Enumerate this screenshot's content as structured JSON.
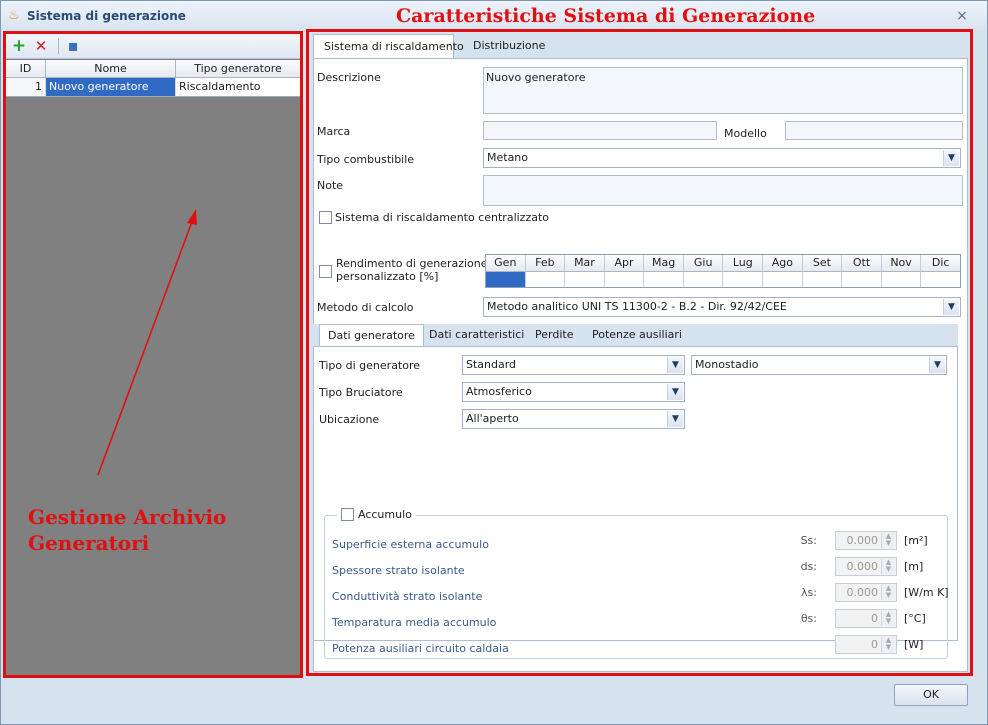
{
  "window": {
    "title": "Sistema di generazione",
    "close": "×"
  },
  "annotations": {
    "right_title": "Caratteristiche Sistema di Generazione",
    "left_title": "Gestione Archivio Generatori"
  },
  "left": {
    "toolbar": {
      "add": "+",
      "delete": "✕",
      "save": "▪"
    },
    "grid": {
      "headers": [
        "ID",
        "Nome",
        "Tipo generatore"
      ],
      "rows": [
        {
          "id": "1",
          "nome": "Nuovo generatore",
          "tipo": "Riscaldamento"
        }
      ]
    }
  },
  "tabs": [
    "Sistema di riscaldamento",
    "Distribuzione"
  ],
  "form": {
    "descrizione_label": "Descrizione",
    "descrizione_value": "Nuovo generatore",
    "marca_label": "Marca",
    "modello_label": "Modello",
    "combustibile_label": "Tipo combustibile",
    "combustibile_value": "Metano",
    "note_label": "Note",
    "centralizzato_label": "Sistema di riscaldamento centralizzato",
    "rendimento_label_1": "Rendimento di generazione",
    "rendimento_label_2": "personalizzato [%]",
    "months": [
      "Gen",
      "Feb",
      "Mar",
      "Apr",
      "Mag",
      "Giu",
      "Lug",
      "Ago",
      "Set",
      "Ott",
      "Nov",
      "Dic"
    ],
    "metodo_label": "Metodo di calcolo",
    "metodo_value": "Metodo analitico UNI TS 11300-2 - B.2 - Dir. 92/42/CEE"
  },
  "subtabs": [
    "Dati generatore",
    "Dati caratteristici",
    "Perdite",
    "Potenze ausiliari"
  ],
  "dati": {
    "tipo_gen_label": "Tipo di generatore",
    "tipo_gen_value": "Standard",
    "stadio_value": "Monostadio",
    "bruciatore_label": "Tipo Bruciatore",
    "bruciatore_value": "Atmosferico",
    "ubicazione_label": "Ubicazione",
    "ubicazione_value": "All'aperto"
  },
  "accumulo": {
    "label": "Accumulo",
    "rows": [
      {
        "label": "Superficie esterna accumulo",
        "sym": "Ss:",
        "value": "0.000",
        "unit": "[m²]"
      },
      {
        "label": "Spessore strato isolante",
        "sym": "ds:",
        "value": "0.000",
        "unit": "[m]"
      },
      {
        "label": "Conduttività strato isolante",
        "sym": "λs:",
        "value": "0.000",
        "unit": "[W/m K]"
      },
      {
        "label": "Temparatura media accumulo",
        "sym": "θs:",
        "value": "0",
        "unit": "[°C]"
      },
      {
        "label": "Potenza ausiliari circuito caldaia",
        "sym": "",
        "value": "0",
        "unit": "[W]"
      }
    ]
  },
  "ok_label": "OK",
  "colors": {
    "annotation": "#e01010",
    "selection": "#316ac5"
  }
}
